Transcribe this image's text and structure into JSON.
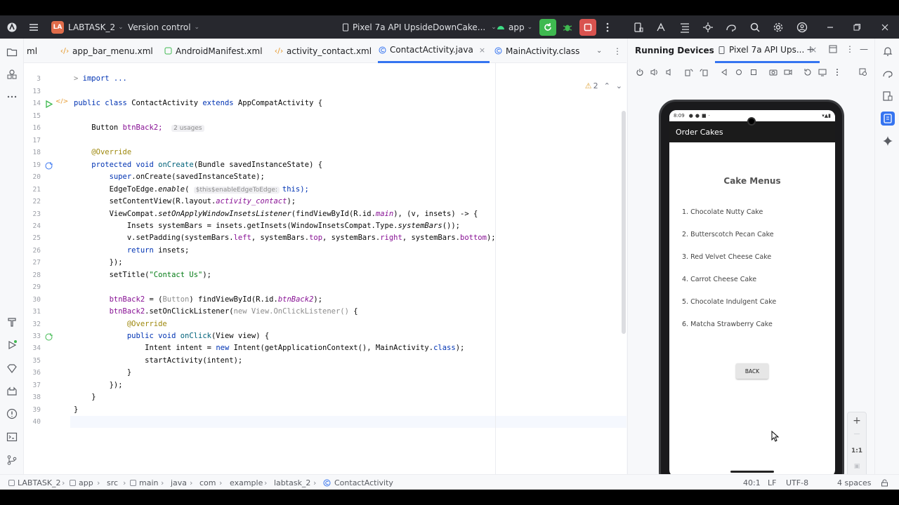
{
  "titlebar": {
    "project_badge": "LA",
    "project_name": "LABTASK_2",
    "vcs": "Version control",
    "device": "Pixel 7a API UpsideDownCake...",
    "run_config": "app"
  },
  "tabs": [
    {
      "label": "ml",
      "icon": "xml-icon"
    },
    {
      "label": "app_bar_menu.xml",
      "icon": "xml-icon"
    },
    {
      "label": "AndroidManifest.xml",
      "icon": "manifest-icon"
    },
    {
      "label": "activity_contact.xml",
      "icon": "xml-icon"
    },
    {
      "label": "ContactActivity.java",
      "icon": "class-icon",
      "active": true
    },
    {
      "label": "MainActivity.class",
      "icon": "class-icon"
    }
  ],
  "editor": {
    "warning_count": "2",
    "line_numbers": [
      "3",
      "13",
      "14",
      "15",
      "16",
      "17",
      "18",
      "19",
      "20",
      "21",
      "22",
      "23",
      "24",
      "25",
      "26",
      "27",
      "28",
      "29",
      "30",
      "31",
      "32",
      "33",
      "34",
      "35",
      "36",
      "37",
      "38",
      "39",
      "40"
    ],
    "usages_hint": "2 usages",
    "param_hint": "$this$enableEdgeToEdge:",
    "code": {
      "l3": "import ...",
      "l14a": "public class ",
      "l14b": "ContactActivity ",
      "l14c": "extends ",
      "l14d": "AppCompatActivity {",
      "l16a": "Button ",
      "l16b": "btnBack2;",
      "l18": "@Override",
      "l19a": "protected void ",
      "l19b": "onCreate",
      "l19c": "(Bundle savedInstanceState) {",
      "l20a": "super",
      "l20b": ".onCreate(savedInstanceState);",
      "l21a": "EdgeToEdge.",
      "l21b": "enable",
      "l21c": "(",
      "l21d": "this);",
      "l22a": "setContentView(R.layout.",
      "l22b": "activity_contact",
      "l22c": ");",
      "l23a": "ViewCompat.",
      "l23b": "setOnApplyWindowInsetsListener",
      "l23c": "(findViewById(R.id.",
      "l23d": "main",
      "l23e": "), (v, insets) -> {",
      "l24a": "Insets systemBars = insets.getInsets(WindowInsetsCompat.Type.",
      "l24b": "systemBars",
      "l24c": "());",
      "l25a": "v.setPadding(systemBars.",
      "l25b": "left",
      "l25c": ", systemBars.",
      "l25d": "top",
      "l25e": ", systemBars.",
      "l25f": "right",
      "l25g": ", systemBars.",
      "l25h": "bottom",
      "l25i": ");",
      "l26a": "return ",
      "l26b": "insets;",
      "l27": "});",
      "l28a": "setTitle(",
      "l28b": "\"Contact Us\"",
      "l28c": ");",
      "l30a": "btnBack2",
      "l30b": " = (",
      "l30c": "Button",
      "l30d": ") findViewById(R.id.",
      "l30e": "btnBack2",
      "l30f": ");",
      "l31a": "btnBack2",
      "l31b": ".setOnClickListener(",
      "l31c": "new View.OnClickListener() ",
      "l31d": "{",
      "l32": "@Override",
      "l33a": "public void ",
      "l33b": "onClick",
      "l33c": "(View view) {",
      "l34a": "Intent intent = ",
      "l34b": "new ",
      "l34c": "Intent(getApplicationContext(), MainActivity.",
      "l34d": "class",
      "l34e": ");",
      "l35": "startActivity(intent);",
      "l36": "}",
      "l37": "});",
      "l38": "}",
      "l39": "}"
    }
  },
  "running_devices": {
    "title": "Running Devices",
    "device_tab": "Pixel 7a API Ups...",
    "zoom_label": "1:1"
  },
  "phone": {
    "time": "8:09",
    "app_title": "Order Cakes",
    "menu_title": "Cake Menus",
    "items": [
      "1. Chocolate Nutty Cake",
      "2. Butterscotch Pecan Cake",
      "3. Red Velvet Cheese Cake",
      "4. Carrot Cheese Cake",
      "5. Chocolate Indulgent Cake",
      "6. Matcha Strawberry Cake"
    ],
    "back_button": "BACK"
  },
  "statusbar": {
    "breadcrumbs": [
      "LABTASK_2",
      "app",
      "src",
      "main",
      "java",
      "com",
      "example",
      "labtask_2",
      "ContactActivity"
    ],
    "position": "40:1",
    "line_sep": "LF",
    "encoding": "UTF-8",
    "indent": "4 spaces"
  },
  "colors": {
    "accent": "#3574f0",
    "run_green": "#3fb950",
    "stop_red": "#d9534f",
    "titlebar": "#27282e"
  }
}
